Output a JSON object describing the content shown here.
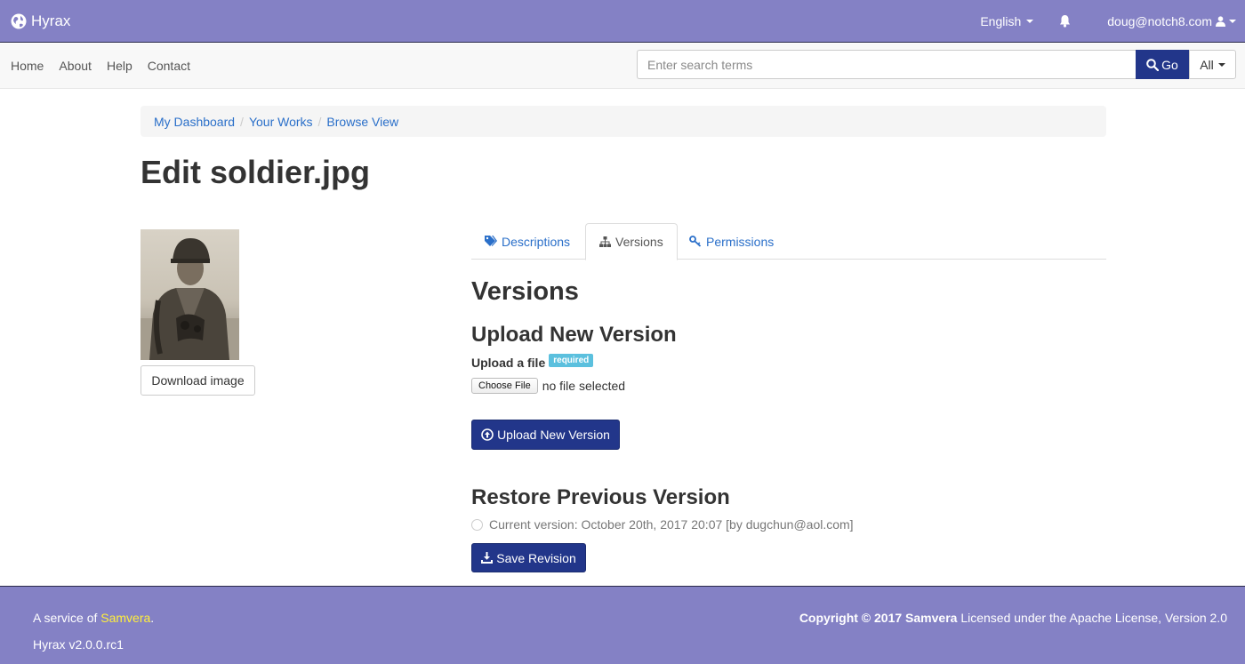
{
  "header": {
    "brand": "Hyrax",
    "language": "English",
    "user": "doug@notch8.com",
    "icons": {
      "brand": "globe-icon",
      "notifications": "bell-icon",
      "user": "user-icon"
    }
  },
  "nav": {
    "links": [
      "Home",
      "About",
      "Help",
      "Contact"
    ],
    "search_placeholder": "Enter search terms",
    "search_value": "",
    "go_label": "Go",
    "scope_label": "All"
  },
  "breadcrumb": [
    "My Dashboard",
    "Your Works",
    "Browse View"
  ],
  "page": {
    "title": "Edit soldier.jpg",
    "download_label": "Download image"
  },
  "tabs": [
    {
      "label": "Descriptions",
      "icon": "tags-icon"
    },
    {
      "label": "Versions",
      "icon": "sitemap-icon",
      "active": true
    },
    {
      "label": "Permissions",
      "icon": "key-icon"
    }
  ],
  "versions": {
    "heading": "Versions",
    "upload_heading": "Upload New Version",
    "upload_label": "Upload a file",
    "required_badge": "required",
    "choose_file_label": "Choose File",
    "file_status": "no file selected",
    "upload_button": "Upload New Version",
    "restore_heading": "Restore Previous Version",
    "current_version": "Current version: October 20th, 2017 20:07 [by dugchun@aol.com]",
    "save_button": "Save Revision"
  },
  "footer": {
    "service_prefix": "A service of ",
    "service_link": "Samvera",
    "service_suffix": ".",
    "version": "Hyrax v2.0.0.rc1",
    "copyright_bold": "Copyright © 2017 Samvera",
    "license": " Licensed under the Apache License, Version 2.0"
  },
  "colors": {
    "header_bg": "#8481c5",
    "primary": "#22368a",
    "link": "#2a6fc9",
    "footer_link": "#ffef3c",
    "badge": "#5bc0de"
  }
}
